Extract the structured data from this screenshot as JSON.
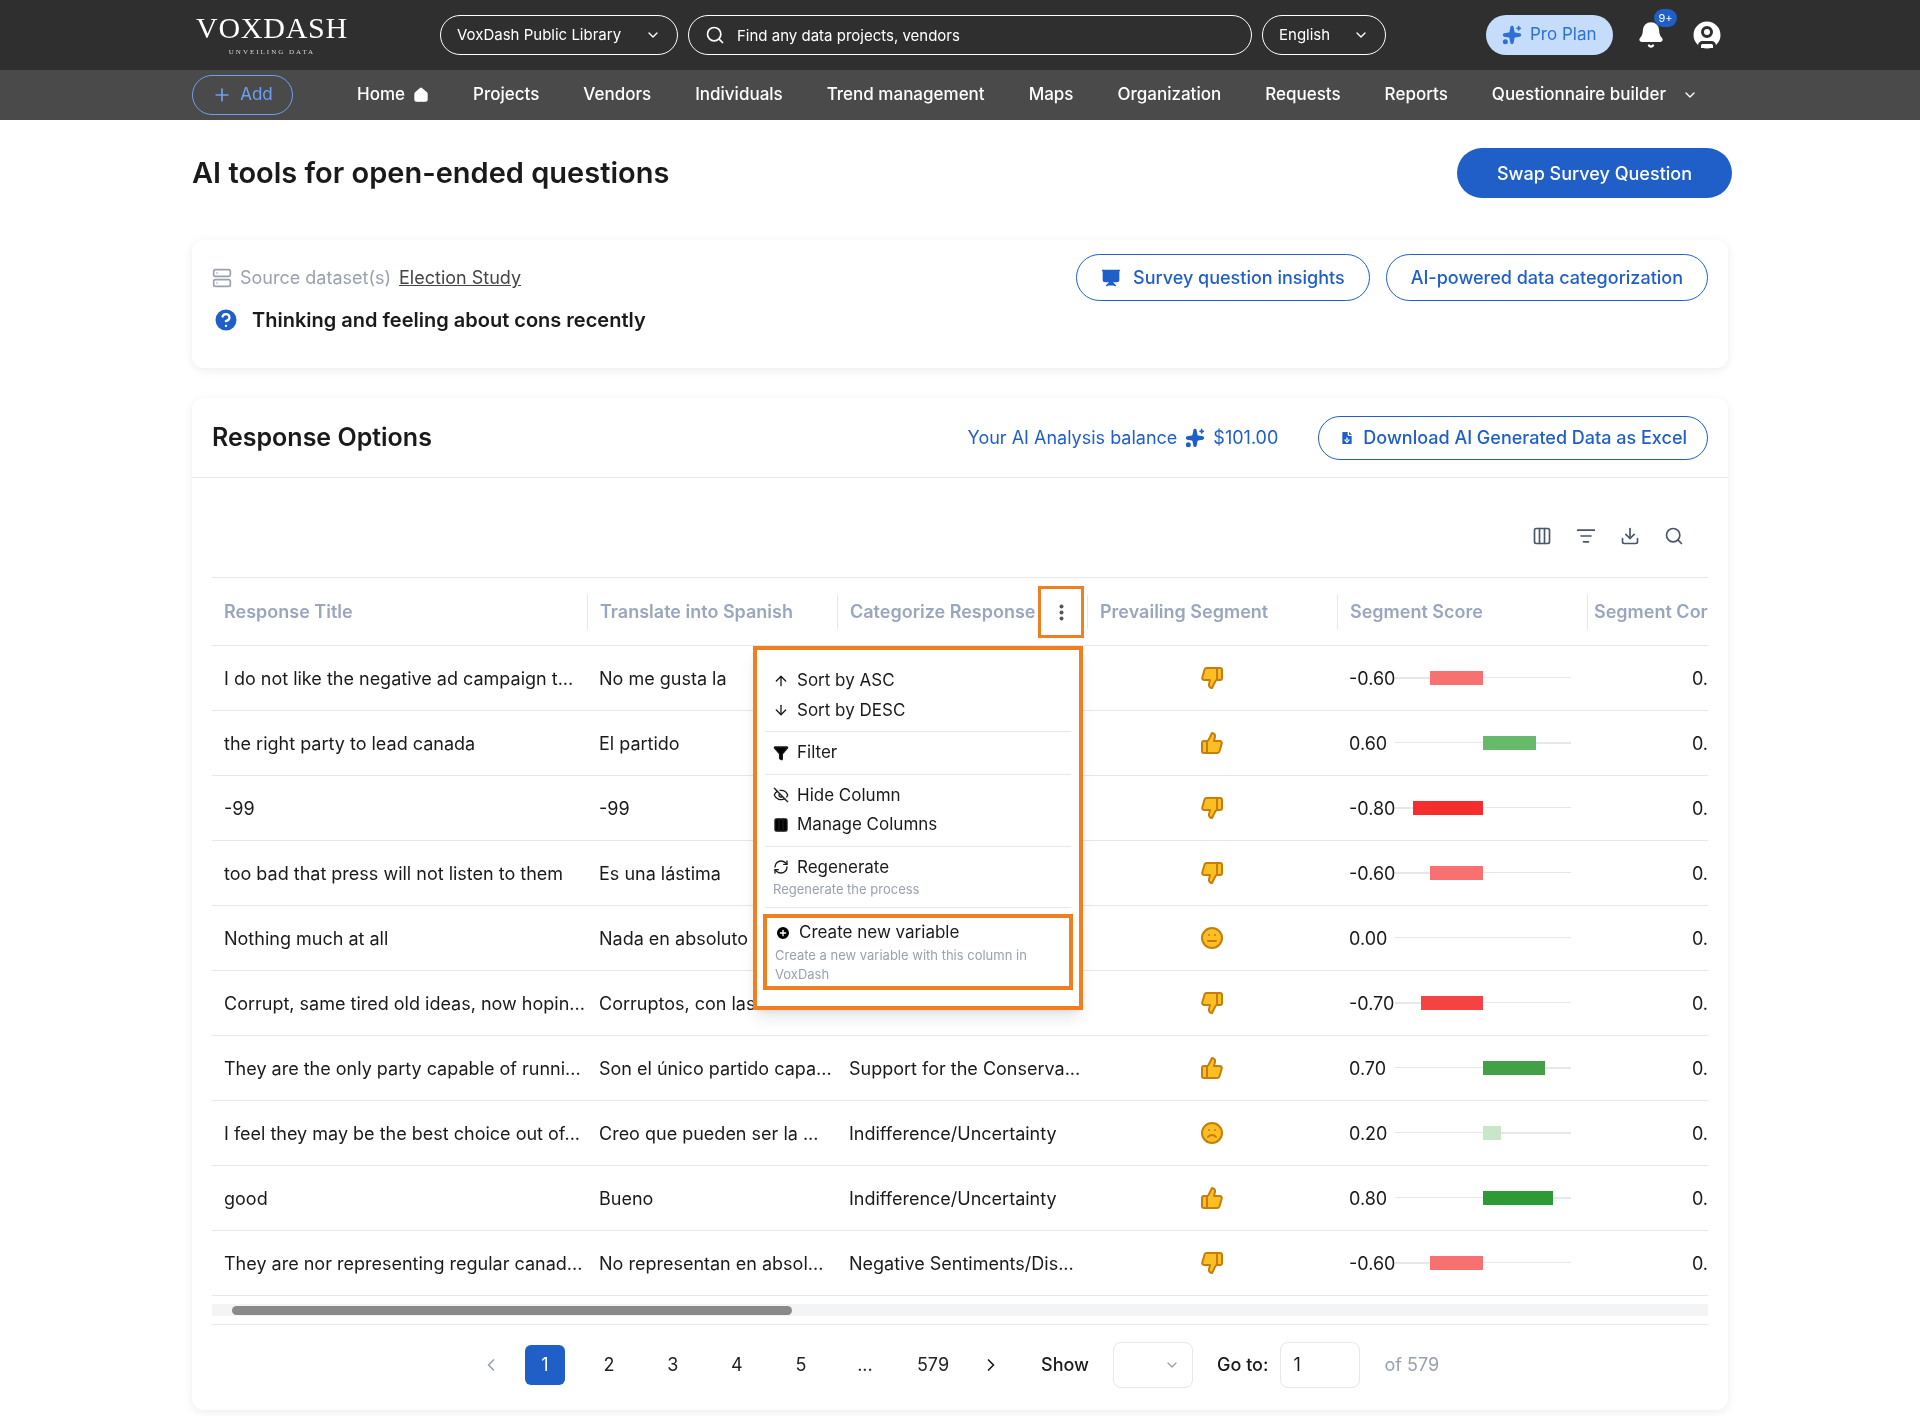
{
  "header": {
    "logo": "VOXDASH",
    "tagline": "UNVEILING DATA",
    "library_select": "VoxDash Public Library",
    "search": {
      "placeholder": "Find any data projects, vendors"
    },
    "language_select": "English",
    "plan_button": "Pro Plan",
    "notification_badge": "9+"
  },
  "nav": {
    "add_button": "Add",
    "items": [
      {
        "label": "Home",
        "kind": "home"
      },
      {
        "label": "Projects",
        "kind": "plain"
      },
      {
        "label": "Vendors",
        "kind": "plain"
      },
      {
        "label": "Individuals",
        "kind": "plain"
      },
      {
        "label": "Trend management",
        "kind": "plain"
      },
      {
        "label": "Maps",
        "kind": "plain"
      },
      {
        "label": "Organization",
        "kind": "plain"
      },
      {
        "label": "Requests",
        "kind": "plain"
      },
      {
        "label": "Reports",
        "kind": "plain"
      },
      {
        "label": "Questionnaire builder",
        "kind": "dropdown"
      }
    ]
  },
  "page": {
    "title": "AI tools for open-ended questions",
    "swap_button": "Swap Survey Question"
  },
  "source": {
    "label": "Source dataset(s)",
    "link": "Election Study",
    "question": "Thinking and feeling about cons recently",
    "buttons": [
      {
        "label": "Survey question insights",
        "kind": "insights"
      },
      {
        "label": "AI-powered data categorization",
        "kind": "plain"
      }
    ]
  },
  "response_options": {
    "title": "Response Options",
    "balance_label": "Your AI Analysis balance",
    "balance": "$101.00",
    "download_button": "Download AI Generated Data as Excel"
  },
  "table": {
    "columns": [
      "Response Title",
      "Translate into Spanish",
      "Categorize Response",
      "Prevailing Segment",
      "Segment Score",
      "Segment Cor"
    ],
    "rows": [
      {
        "title": "I do not like the negative ad campaign t...",
        "spanish": "No me gusta la",
        "segment": {
          "kind": "down"
        },
        "score": "-0.60",
        "bar": {
          "level": 0.6,
          "color": "#f87171",
          "kind": "negative"
        },
        "column_6": "0."
      },
      {
        "title": "the right party to lead canada",
        "spanish": "El partido",
        "segment": {
          "kind": "up"
        },
        "score": "0.60",
        "bar": {
          "level": 0.6,
          "color": "#66bb6a",
          "kind": "positive"
        },
        "column_6": "0."
      },
      {
        "title": "-99",
        "spanish": "-99",
        "segment": {
          "kind": "down"
        },
        "score": "-0.80",
        "bar": {
          "level": 0.8,
          "color": "#f52d2d",
          "kind": "negative"
        },
        "column_6": "0."
      },
      {
        "title": "too bad that press will not listen to them",
        "spanish": "Es una lástima",
        "segment": {
          "kind": "down"
        },
        "score": "-0.60",
        "bar": {
          "level": 0.6,
          "color": "#f87171",
          "kind": "negative"
        },
        "column_6": "0."
      },
      {
        "title": "Nothing much at all",
        "spanish": "Nada en absoluto",
        "segment": {
          "kind": "neutral"
        },
        "score": "0.00",
        "column_6": "0."
      },
      {
        "title": "Corrupt, same tired old ideas, now hopin...",
        "spanish": "Corruptos, con las",
        "segment": {
          "kind": "down"
        },
        "score": "-0.70",
        "bar": {
          "level": 0.7,
          "color": "#f54242",
          "kind": "negative"
        },
        "column_6": "0."
      },
      {
        "title": "They are the only party capable of runni...",
        "spanish": "Son el único partido capa...",
        "category": "Support for the Conserva...",
        "segment": {
          "kind": "up"
        },
        "score": "0.70",
        "bar": {
          "level": 0.7,
          "color": "#43a047",
          "kind": "positive"
        },
        "column_6": "0."
      },
      {
        "title": "I feel they may be the best choice out of...",
        "spanish": "Creo que pueden ser la ...",
        "category": "Indifference/Uncertainty",
        "segment": {
          "kind": "thinking"
        },
        "score": "0.20",
        "bar": {
          "level": 0.2,
          "color": "#c8e6c9",
          "kind": "positive"
        },
        "column_6": "0."
      },
      {
        "title": "good",
        "spanish": "Bueno",
        "category": "Indifference/Uncertainty",
        "segment": {
          "kind": "up"
        },
        "score": "0.80",
        "bar": {
          "level": 0.8,
          "color": "#2e9a36",
          "kind": "positive"
        },
        "column_6": "0."
      },
      {
        "title": "They are nor representing regular canad...",
        "spanish": "No representan en absol...",
        "category": "Negative Sentiments/Dis...",
        "segment": {
          "kind": "down"
        },
        "score": "-0.60",
        "bar": {
          "level": 0.6,
          "color": "#f87171",
          "kind": "negative"
        },
        "column_6": "0."
      }
    ]
  },
  "column_menu": {
    "groups": [
      {
        "items": [
          {
            "kind": "sort_asc",
            "label": "Sort by ASC",
            "highlighted": false
          },
          {
            "kind": "sort_desc",
            "label": "Sort by DESC",
            "highlighted": false
          }
        ]
      },
      {
        "items": [
          {
            "kind": "filter",
            "label": "Filter",
            "highlighted": false
          }
        ]
      },
      {
        "items": [
          {
            "kind": "hide",
            "label": "Hide Column",
            "highlighted": false
          },
          {
            "kind": "manage",
            "label": "Manage Columns",
            "highlighted": false
          }
        ]
      },
      {
        "items": [
          {
            "kind": "regenerate",
            "label": "Regenerate",
            "description": "Regenerate the process",
            "highlighted": false
          }
        ]
      },
      {
        "items": [
          {
            "kind": "create",
            "label": "Create new variable",
            "description": "Create a new variable with this column in VoxDash",
            "highlighted": true
          }
        ]
      }
    ]
  },
  "pagination": {
    "pages": [
      {
        "label": "1",
        "selected": true
      },
      {
        "label": "2",
        "selected": false
      },
      {
        "label": "3",
        "selected": false
      },
      {
        "label": "4",
        "selected": false
      },
      {
        "label": "5",
        "selected": false
      },
      {
        "label": "...",
        "selected": false
      },
      {
        "label": "579",
        "selected": false
      }
    ],
    "show_label": "Show",
    "goto_label": "Go to:",
    "goto_value": "1",
    "total": "of 579"
  }
}
